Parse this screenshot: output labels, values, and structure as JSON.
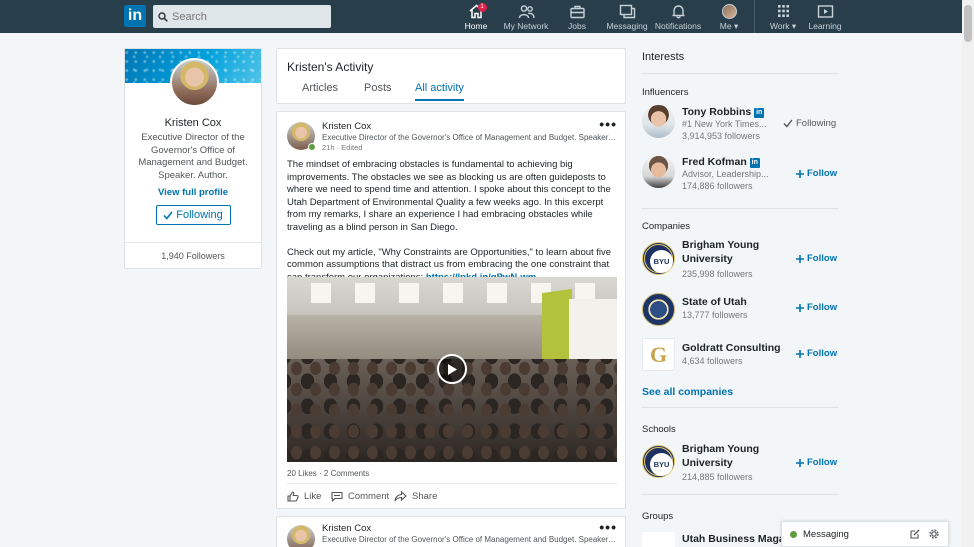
{
  "nav": {
    "logo": "in",
    "search_placeholder": "Search",
    "items": [
      {
        "label": "Home",
        "icon": "home-icon",
        "badge": "1"
      },
      {
        "label": "My Network",
        "icon": "network-icon"
      },
      {
        "label": "Jobs",
        "icon": "briefcase-icon"
      },
      {
        "label": "Messaging",
        "icon": "messaging-icon"
      },
      {
        "label": "Notifications",
        "icon": "bell-icon"
      },
      {
        "label": "Me",
        "icon": "avatar-icon"
      },
      {
        "label": "Work",
        "icon": "grid-icon"
      },
      {
        "label": "Learning",
        "icon": "play-icon"
      }
    ]
  },
  "profile": {
    "name": "Kristen Cox",
    "headline": "Executive Director of the Governor's Office of Management and Budget. Speaker. Author.",
    "view_profile": "View full profile",
    "following_label": "Following",
    "followers": "1,940 Followers"
  },
  "activity": {
    "title": "Kristen's Activity",
    "tabs": [
      "Articles",
      "Posts",
      "All activity"
    ],
    "active_tab": "All activity"
  },
  "post": {
    "author": "Kristen Cox",
    "headline": "Executive Director of the Governor's Office of Management and Budget. Speaker. Aut...",
    "time": "21h · Edited",
    "para1": "The mindset of embracing obstacles is fundamental to achieving big improvements. The obstacles we see as blocking us are often guideposts to where we need to spend time and attention. I spoke about this concept to the Utah Department of Environmental Quality a few weeks ago. In this excerpt from my remarks, I share an experience I had embracing obstacles while traveling as a blind person in San Diego.",
    "para2": "Check out my article, \"Why Constraints are Opportunities,\" to learn about five common assumptions that distract us from embracing the one constraint that can transform our organizations: ",
    "link": "https://lnkd.in/gPwN-wm",
    "stats": "20 Likes · 2 Comments",
    "actions": [
      "Like",
      "Comment",
      "Share"
    ]
  },
  "post2": {
    "author": "Kristen Cox",
    "headline": "Executive Director of the Governor's Office of Management and Budget. Speaker. Aut..."
  },
  "interests": {
    "title": "Interests",
    "influencers_title": "Influencers",
    "influencers": [
      {
        "name": "Tony Robbins",
        "sub": "#1 New York Times...",
        "followers": "3,914,953 followers",
        "action": "Following"
      },
      {
        "name": "Fred Kofman",
        "sub": "Advisor, Leadership...",
        "followers": "174,886 followers",
        "action": "Follow"
      }
    ],
    "companies_title": "Companies",
    "companies": [
      {
        "name": "Brigham Young University",
        "followers": "235,998 followers",
        "action": "Follow",
        "logo": "BYU"
      },
      {
        "name": "State of Utah",
        "followers": "13,777 followers",
        "action": "Follow"
      },
      {
        "name": "Goldratt Consulting",
        "followers": "4,634 followers",
        "action": "Follow",
        "logo": "G"
      }
    ],
    "see_all": "See all companies",
    "schools_title": "Schools",
    "schools": [
      {
        "name": "Brigham Young University",
        "followers": "214,885 followers",
        "action": "Follow",
        "logo": "BYU"
      }
    ],
    "groups_title": "Groups",
    "groups": [
      {
        "name": "Utah Business Magaz"
      }
    ]
  },
  "messaging": {
    "label": "Messaging"
  },
  "colors": {
    "nav_bg": "#283e4a",
    "brand": "#0073b1",
    "online": "#5f9b41",
    "page_bg": "#f3f6f8"
  }
}
